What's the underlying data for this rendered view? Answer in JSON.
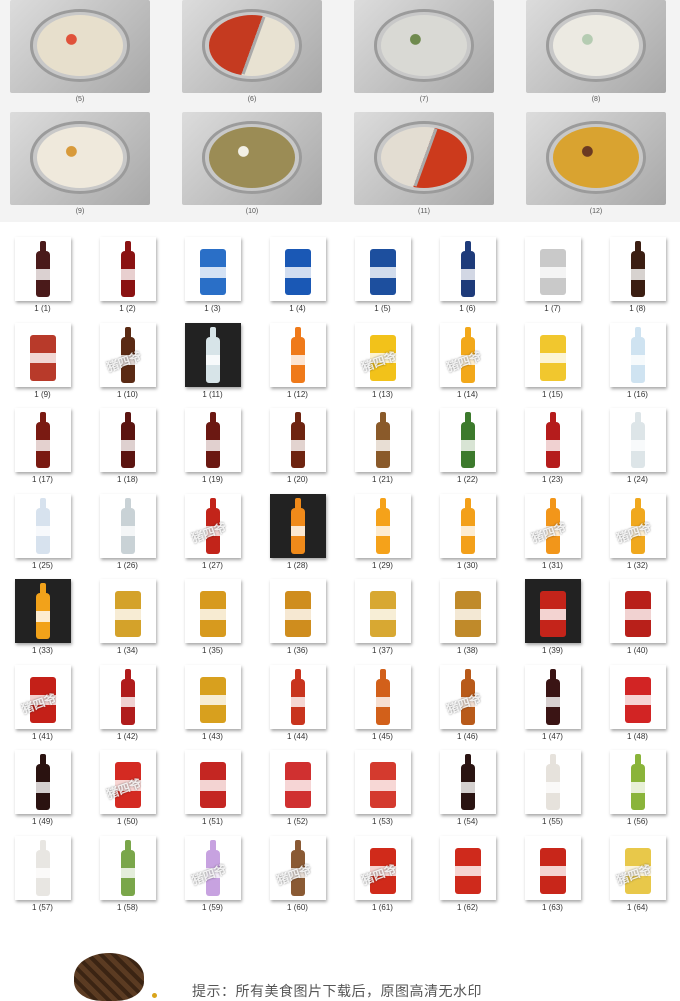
{
  "pots": [
    {
      "caption": "(5)",
      "broth": "#e7dfcc",
      "accent": "#e0523a",
      "split": false
    },
    {
      "caption": "(6)",
      "broth": "#c53a20",
      "accent": "#e8e2d2",
      "split": true
    },
    {
      "caption": "(7)",
      "broth": "#d9d9d4",
      "accent": "#6f8a4e",
      "split": false
    },
    {
      "caption": "(8)",
      "broth": "#eceae2",
      "accent": "#b5ccb2",
      "split": false
    },
    {
      "caption": "(9)",
      "broth": "#efe9dc",
      "accent": "#d89a3a",
      "split": false
    },
    {
      "caption": "(10)",
      "broth": "#9b8c55",
      "accent": "#f2f0e6",
      "split": false
    },
    {
      "caption": "(11)",
      "broth": "#e3ddd2",
      "accent": "#cc3a1c",
      "split": true
    },
    {
      "caption": "(12)",
      "broth": "#d9a330",
      "accent": "#6b3a22",
      "split": false
    }
  ],
  "drinks": [
    {
      "caption": "1 (1)",
      "type": "bottle",
      "color": "#4a1a1a"
    },
    {
      "caption": "1 (2)",
      "type": "bottle",
      "color": "#8a1212"
    },
    {
      "caption": "1 (3)",
      "type": "can",
      "color": "#2a6fc7"
    },
    {
      "caption": "1 (4)",
      "type": "can",
      "color": "#1a58b5"
    },
    {
      "caption": "1 (5)",
      "type": "can",
      "color": "#1d4f9e"
    },
    {
      "caption": "1 (6)",
      "type": "bottle",
      "color": "#1e3b7a"
    },
    {
      "caption": "1 (7)",
      "type": "can",
      "color": "#c9c9c9"
    },
    {
      "caption": "1 (8)",
      "type": "bottle",
      "color": "#3b1e12"
    },
    {
      "caption": "1 (9)",
      "type": "can",
      "color": "#b83a2a"
    },
    {
      "caption": "1 (10)",
      "type": "bottle",
      "color": "#5a2a14"
    },
    {
      "caption": "1 (11)",
      "type": "bottle",
      "color": "#d7e4e8",
      "dark": true
    },
    {
      "caption": "1 (12)",
      "type": "bottle",
      "color": "#ef7a1a"
    },
    {
      "caption": "1 (13)",
      "type": "can",
      "color": "#f2c21a"
    },
    {
      "caption": "1 (14)",
      "type": "bottle",
      "color": "#f2a81a"
    },
    {
      "caption": "1 (15)",
      "type": "can",
      "color": "#f1c72e"
    },
    {
      "caption": "1 (16)",
      "type": "bottle",
      "color": "#cfe3f1"
    },
    {
      "caption": "1 (17)",
      "type": "bottle",
      "color": "#7a1a12"
    },
    {
      "caption": "1 (18)",
      "type": "bottle",
      "color": "#5b1410"
    },
    {
      "caption": "1 (19)",
      "type": "bottle",
      "color": "#6b1812"
    },
    {
      "caption": "1 (20)",
      "type": "bottle",
      "color": "#6e2410"
    },
    {
      "caption": "1 (21)",
      "type": "bottle",
      "color": "#8a5a2a"
    },
    {
      "caption": "1 (22)",
      "type": "bottle",
      "color": "#3c7a2c"
    },
    {
      "caption": "1 (23)",
      "type": "bottle",
      "color": "#b51c1c"
    },
    {
      "caption": "1 (24)",
      "type": "bottle",
      "color": "#dde5e8"
    },
    {
      "caption": "1 (25)",
      "type": "bottle",
      "color": "#d7e2ee"
    },
    {
      "caption": "1 (26)",
      "type": "bottle",
      "color": "#c9d2d6"
    },
    {
      "caption": "1 (27)",
      "type": "bottle",
      "color": "#c2241a"
    },
    {
      "caption": "1 (28)",
      "type": "bottle",
      "color": "#f08a1a",
      "dark": true
    },
    {
      "caption": "1 (29)",
      "type": "bottle",
      "color": "#f5a21a"
    },
    {
      "caption": "1 (30)",
      "type": "bottle",
      "color": "#f3a01a"
    },
    {
      "caption": "1 (31)",
      "type": "bottle",
      "color": "#f2961a"
    },
    {
      "caption": "1 (32)",
      "type": "bottle",
      "color": "#f0a81e"
    },
    {
      "caption": "1 (33)",
      "type": "bottle",
      "color": "#f2a21a",
      "dark": true
    },
    {
      "caption": "1 (34)",
      "type": "can",
      "color": "#d4a22a"
    },
    {
      "caption": "1 (35)",
      "type": "can",
      "color": "#d79a1e"
    },
    {
      "caption": "1 (36)",
      "type": "can",
      "color": "#cf8d1e"
    },
    {
      "caption": "1 (37)",
      "type": "can",
      "color": "#d8a832"
    },
    {
      "caption": "1 (38)",
      "type": "can",
      "color": "#c08a2a"
    },
    {
      "caption": "1 (39)",
      "type": "can",
      "color": "#c4241a",
      "dark": true
    },
    {
      "caption": "1 (40)",
      "type": "can",
      "color": "#b8201a"
    },
    {
      "caption": "1 (41)",
      "type": "can",
      "color": "#c42018"
    },
    {
      "caption": "1 (42)",
      "type": "bottle",
      "color": "#b01c1c"
    },
    {
      "caption": "1 (43)",
      "type": "can",
      "color": "#d8a01e"
    },
    {
      "caption": "1 (44)",
      "type": "bottle",
      "color": "#c8341e"
    },
    {
      "caption": "1 (45)",
      "type": "bottle",
      "color": "#d2601a"
    },
    {
      "caption": "1 (46)",
      "type": "bottle",
      "color": "#b85a1a"
    },
    {
      "caption": "1 (47)",
      "type": "bottle",
      "color": "#3a1414"
    },
    {
      "caption": "1 (48)",
      "type": "can",
      "color": "#d22424"
    },
    {
      "caption": "1 (49)",
      "type": "bottle",
      "color": "#2a1210"
    },
    {
      "caption": "1 (50)",
      "type": "can",
      "color": "#d42a22"
    },
    {
      "caption": "1 (51)",
      "type": "can",
      "color": "#c42622"
    },
    {
      "caption": "1 (52)",
      "type": "can",
      "color": "#d03030"
    },
    {
      "caption": "1 (53)",
      "type": "can",
      "color": "#d43a2e"
    },
    {
      "caption": "1 (54)",
      "type": "bottle",
      "color": "#2a1412"
    },
    {
      "caption": "1 (55)",
      "type": "bottle",
      "color": "#e6e2dc"
    },
    {
      "caption": "1 (56)",
      "type": "bottle",
      "color": "#8ab43a"
    },
    {
      "caption": "1 (57)",
      "type": "bottle",
      "color": "#e8e6e2"
    },
    {
      "caption": "1 (58)",
      "type": "bottle",
      "color": "#7aa64a"
    },
    {
      "caption": "1 (59)",
      "type": "bottle",
      "color": "#c7a2e0"
    },
    {
      "caption": "1 (60)",
      "type": "bottle",
      "color": "#8a5a34"
    },
    {
      "caption": "1 (61)",
      "type": "can",
      "color": "#d02a1a"
    },
    {
      "caption": "1 (62)",
      "type": "can",
      "color": "#cf2a1c"
    },
    {
      "caption": "1 (63)",
      "type": "can",
      "color": "#c8261a"
    },
    {
      "caption": "1 (64)",
      "type": "can",
      "color": "#e8c84a"
    }
  ],
  "watermark_text": "猪四爷",
  "footer": {
    "tip": "提示：所有美食图片下载后，原图高清无水印"
  }
}
